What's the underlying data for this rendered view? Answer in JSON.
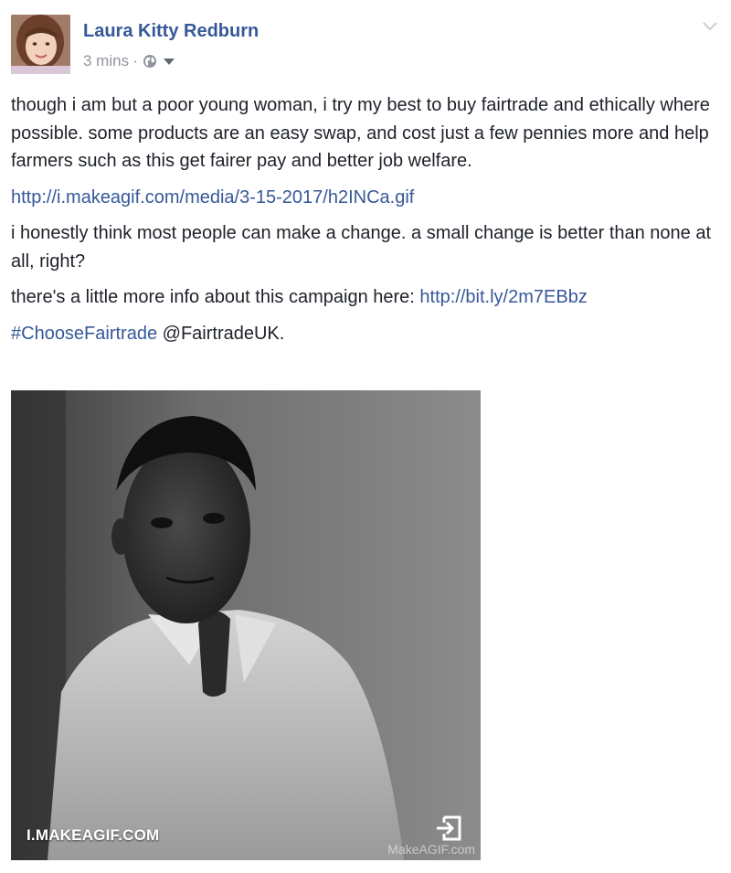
{
  "post": {
    "author": "Laura Kitty Redburn",
    "time": "3 mins",
    "separator": "·",
    "privacy_icon": "globe-icon",
    "audience_icon": "caret-down-icon",
    "menu_icon": "chevron-down-icon"
  },
  "content": {
    "p1": "though i am but a poor young woman, i try my best to buy fairtrade and ethically where possible. some products are an easy swap, and cost just a few pennies more and help farmers such as this get fairer pay and better job welfare.",
    "link1": "http://i.makeagif.com/media/3-15-2017/h2INCa.gif",
    "p2": "i honestly think most people can make a change. a small change is better than none at all, right?",
    "p3_text": "there's a little more info about this campaign here: ",
    "p3_link": "http://bit.ly/2m7EBbz",
    "hashtag": "#ChooseFairtrade",
    "mention": " @FairtradeUK."
  },
  "media": {
    "site_label": "I.MAKEAGIF.COM",
    "watermark": "MakeAGIF.com",
    "open_icon": "open-external-icon"
  },
  "colors": {
    "link": "#365899",
    "text": "#1d2129",
    "meta": "#90949c"
  }
}
